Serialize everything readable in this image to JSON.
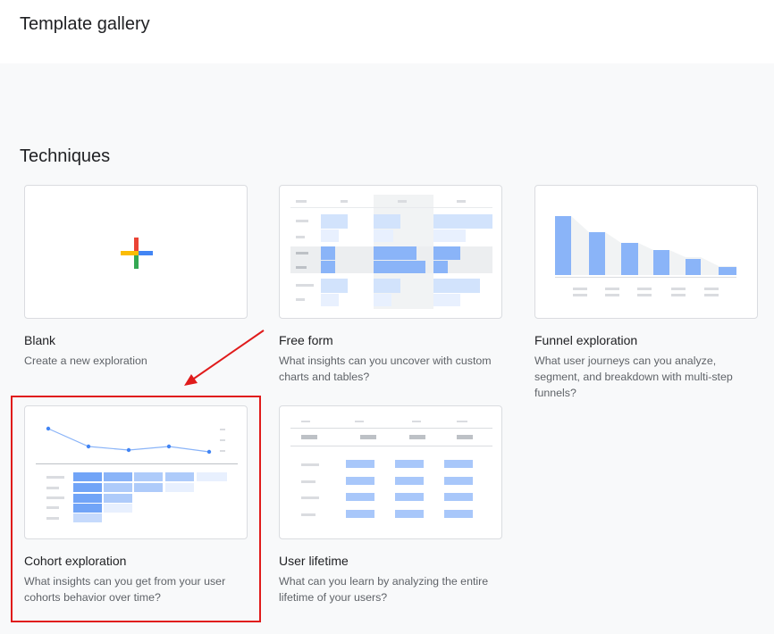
{
  "header": {
    "title": "Template gallery"
  },
  "section": {
    "title": "Techniques"
  },
  "cards": [
    {
      "title": "Blank",
      "description": "Create a new exploration",
      "thumbnail": "plus-icon"
    },
    {
      "title": "Free form",
      "description": "What insights can you uncover with custom charts and tables?",
      "thumbnail": "table-icon"
    },
    {
      "title": "Funnel exploration",
      "description": "What user journeys can you analyze, segment, and breakdown with multi-step funnels?",
      "thumbnail": "funnel-chart-icon"
    },
    {
      "title": "Cohort exploration",
      "description": "What insights can you get from your user cohorts behavior over time?",
      "thumbnail": "cohort-chart-icon"
    },
    {
      "title": "User lifetime",
      "description": "What can you learn by analyzing the entire lifetime of your users?",
      "thumbnail": "lifetime-table-icon"
    }
  ],
  "colors": {
    "accent_blue": "#8ab4f8",
    "light_blue": "#d2e3fc",
    "highlight_red": "#e01b1b"
  }
}
